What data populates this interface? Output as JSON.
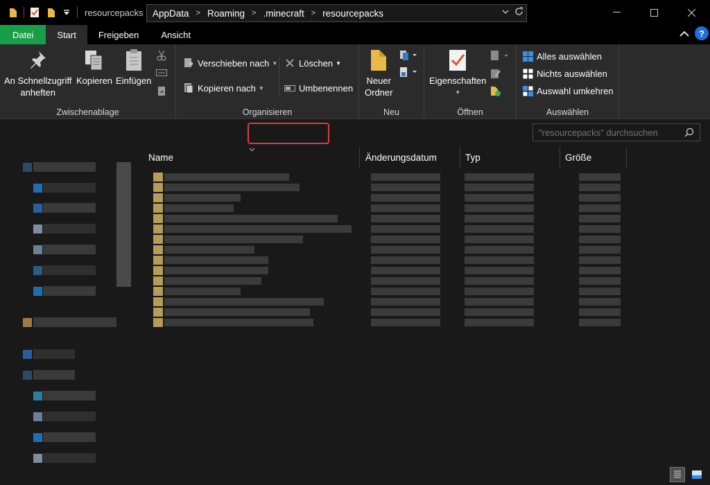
{
  "window": {
    "title": "resourcepacks",
    "controls": [
      "minimize",
      "maximize",
      "close"
    ]
  },
  "ribbon_tabs": [
    {
      "label": "Datei"
    },
    {
      "label": "Start"
    },
    {
      "label": "Freigeben"
    },
    {
      "label": "Ansicht"
    }
  ],
  "ribbon": {
    "clipboard": {
      "group_label": "Zwischenablage",
      "pin_label_1": "An Schnellzugriff",
      "pin_label_2": "anheften",
      "copy_label": "Kopieren",
      "paste_label": "Einfügen"
    },
    "organize": {
      "group_label": "Organisieren",
      "move_label": "Verschieben nach",
      "copy_to_label": "Kopieren nach",
      "delete_label": "Löschen",
      "rename_label": "Umbenennen"
    },
    "new": {
      "group_label": "Neu",
      "new_folder_1": "Neuer",
      "new_folder_2": "Ordner"
    },
    "open": {
      "group_label": "Öffnen",
      "properties_label": "Eigenschaften"
    },
    "select": {
      "group_label": "Auswählen",
      "select_all": "Alles auswählen",
      "select_none": "Nichts auswählen",
      "invert": "Auswahl umkehren"
    }
  },
  "address": {
    "crumbs": [
      "AppData",
      "Roaming",
      ".minecraft",
      "resourcepacks"
    ],
    "highlighted": ".minecraft"
  },
  "search": {
    "placeholder": "\"resourcepacks\" durchsuchen"
  },
  "columns": {
    "name": "Name",
    "date": "Änderungsdatum",
    "type": "Typ",
    "size": "Größe"
  },
  "colors": {
    "file_tab": "#1a9d49",
    "highlight": "#e23b3b",
    "folder": "#e8b94a",
    "help": "#1f6fd6"
  }
}
